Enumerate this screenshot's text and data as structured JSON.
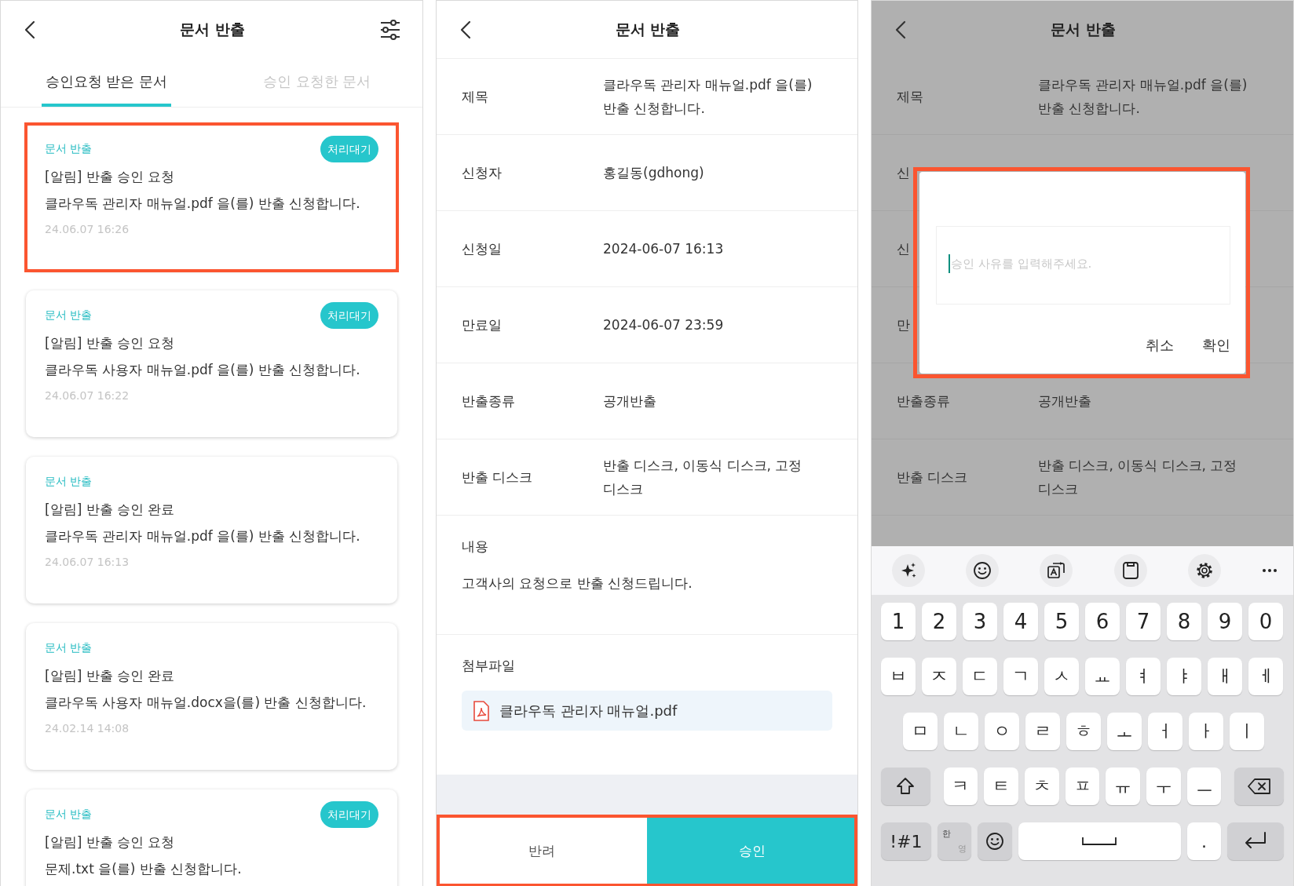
{
  "list_screen": {
    "title": "문서 반출",
    "tabs": [
      {
        "label": "승인요청 받은 문서",
        "selected": true
      },
      {
        "label": "승인 요청한 문서",
        "selected": false
      }
    ],
    "cards": [
      {
        "category": "문서 반출",
        "status": "처리대기",
        "title": "[알림] 반출 승인 요청",
        "body": "클라우독 관리자 매뉴얼.pdf 을(를) 반출 신청합니다.",
        "date": "24.06.07 16:26",
        "highlighted": true
      },
      {
        "category": "문서 반출",
        "status": "처리대기",
        "title": "[알림] 반출 승인 요청",
        "body": "클라우독 사용자 매뉴얼.pdf 을(를) 반출 신청합니다.",
        "date": "24.06.07 16:22",
        "highlighted": false
      },
      {
        "category": "문서 반출",
        "title": "[알림] 반출 승인 완료",
        "body": "클라우독 관리자 매뉴얼.pdf 을(를) 반출 신청합니다.",
        "date": "24.06.07 16:13",
        "highlighted": false
      },
      {
        "category": "문서 반출",
        "title": "[알림] 반출 승인 완료",
        "body": "클라우독 사용자 매뉴얼.docx을(를) 반출 신청합니다.",
        "date": "24.02.14 14:08",
        "highlighted": false
      },
      {
        "category": "문서 반출",
        "status": "처리대기",
        "title": "[알림] 반출 승인 요청",
        "body": "문제.txt 을(를) 반출 신청합니다.",
        "highlighted": false
      }
    ]
  },
  "detail_screen": {
    "title": "문서 반출",
    "fields": [
      {
        "label": "제목",
        "value": "클라우독 관리자 매뉴얼.pdf 을(를) 반출 신청합니다."
      },
      {
        "label": "신청자",
        "value": "홍길동(gdhong)"
      },
      {
        "label": "신청일",
        "value": "2024-06-07 16:13"
      },
      {
        "label": "만료일",
        "value": "2024-06-07 23:59"
      },
      {
        "label": "반출종류",
        "value": "공개반출"
      },
      {
        "label": "반출 디스크",
        "value": "반출 디스크, 이동식 디스크, 고정 디스크"
      }
    ],
    "content": {
      "label": "내용",
      "text": "고객사의 요청으로 반출 신청드립니다."
    },
    "attachment": {
      "label": "첨부파일",
      "file": "클라우독 관리자 매뉴얼.pdf"
    },
    "action_bar": {
      "highlighted": true,
      "buttons": [
        {
          "label": "반려",
          "kind": "secondary"
        },
        {
          "label": "승인",
          "kind": "primary"
        }
      ]
    }
  },
  "dialog_screen": {
    "title": "문서 반출",
    "dimmed": true,
    "fields": [
      {
        "label": "제목",
        "value": "클라우독 관리자 매뉴얼.pdf 을(를) 반출 신청합니다."
      },
      {
        "label": "신"
      },
      {
        "label": "신"
      },
      {
        "label": "만"
      },
      {
        "label": "반출종류",
        "value": "공개반출"
      },
      {
        "label": "반출 디스크",
        "value": "반출 디스크, 이동식 디스크, 고정 디스크"
      }
    ],
    "dialog": {
      "highlighted": true,
      "focused": true,
      "placeholder": "승인 사유를 입력해주세요.",
      "buttons": [
        {
          "label": "취소"
        },
        {
          "label": "확인"
        }
      ]
    },
    "keyboard": {
      "rows": [
        [
          {
            "kind": "char",
            "label": "1"
          },
          {
            "kind": "char",
            "label": "2"
          },
          {
            "kind": "char",
            "label": "3"
          },
          {
            "kind": "char",
            "label": "4"
          },
          {
            "kind": "char",
            "label": "5"
          },
          {
            "kind": "char",
            "label": "6"
          },
          {
            "kind": "char",
            "label": "7"
          },
          {
            "kind": "char",
            "label": "8"
          },
          {
            "kind": "char",
            "label": "9"
          },
          {
            "kind": "char",
            "label": "0"
          }
        ],
        [
          {
            "kind": "char",
            "label": "ㅂ"
          },
          {
            "kind": "char",
            "label": "ㅈ"
          },
          {
            "kind": "char",
            "label": "ㄷ"
          },
          {
            "kind": "char",
            "label": "ㄱ"
          },
          {
            "kind": "char",
            "label": "ㅅ"
          },
          {
            "kind": "char",
            "label": "ㅛ"
          },
          {
            "kind": "char",
            "label": "ㅕ"
          },
          {
            "kind": "char",
            "label": "ㅑ"
          },
          {
            "kind": "char",
            "label": "ㅐ"
          },
          {
            "kind": "char",
            "label": "ㅔ"
          }
        ],
        [
          {
            "kind": "char",
            "label": "ㅁ"
          },
          {
            "kind": "char",
            "label": "ㄴ"
          },
          {
            "kind": "char",
            "label": "ㅇ"
          },
          {
            "kind": "char",
            "label": "ㄹ"
          },
          {
            "kind": "char",
            "label": "ㅎ"
          },
          {
            "kind": "char",
            "label": "ㅗ"
          },
          {
            "kind": "char",
            "label": "ㅓ"
          },
          {
            "kind": "char",
            "label": "ㅏ"
          },
          {
            "kind": "char",
            "label": "ㅣ"
          }
        ],
        [
          {
            "kind": "shift"
          },
          {
            "kind": "char",
            "label": "ㅋ"
          },
          {
            "kind": "char",
            "label": "ㅌ"
          },
          {
            "kind": "char",
            "label": "ㅊ"
          },
          {
            "kind": "char",
            "label": "ㅍ"
          },
          {
            "kind": "char",
            "label": "ㅠ"
          },
          {
            "kind": "char",
            "label": "ㅜ"
          },
          {
            "kind": "char",
            "label": "ㅡ"
          },
          {
            "kind": "backspace"
          }
        ],
        [
          {
            "kind": "symbols",
            "label": "!#1"
          },
          {
            "kind": "lang",
            "top": "한",
            "bottom": "영"
          },
          {
            "kind": "emoji"
          },
          {
            "kind": "space"
          },
          {
            "kind": "char",
            "label": "."
          },
          {
            "kind": "enter"
          }
        ]
      ]
    }
  }
}
